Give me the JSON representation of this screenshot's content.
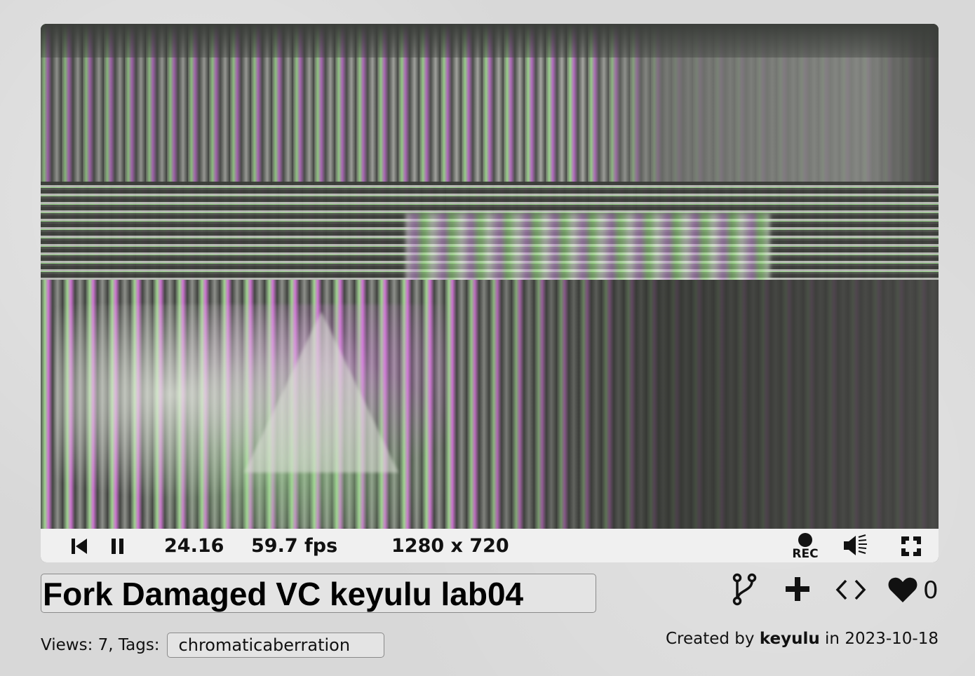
{
  "player": {
    "time": "24.16",
    "fps": "59.7 fps",
    "resolution": "1280 x 720",
    "rec_label": "REC"
  },
  "shader": {
    "title": "Fork Damaged VC keyulu lab04",
    "views_label": "Views: 7, Tags:",
    "tag": "chromaticaberration",
    "likes": "0",
    "created_prefix": "Created by",
    "author": "keyulu",
    "created_mid": "in",
    "date": "2023-10-18"
  },
  "icons": {
    "rewind": "skip-back-icon",
    "pause": "pause-icon",
    "record": "record-icon",
    "volume": "volume-icon",
    "fullscreen": "fullscreen-icon",
    "fork": "fork-icon",
    "add": "plus-icon",
    "embed": "code-icon",
    "like": "heart-icon"
  },
  "colors": {
    "page_bg": "#d8d8d8",
    "controls_bg": "#f0f0f0",
    "input_bg": "#e4e4e4",
    "text": "#111111"
  }
}
